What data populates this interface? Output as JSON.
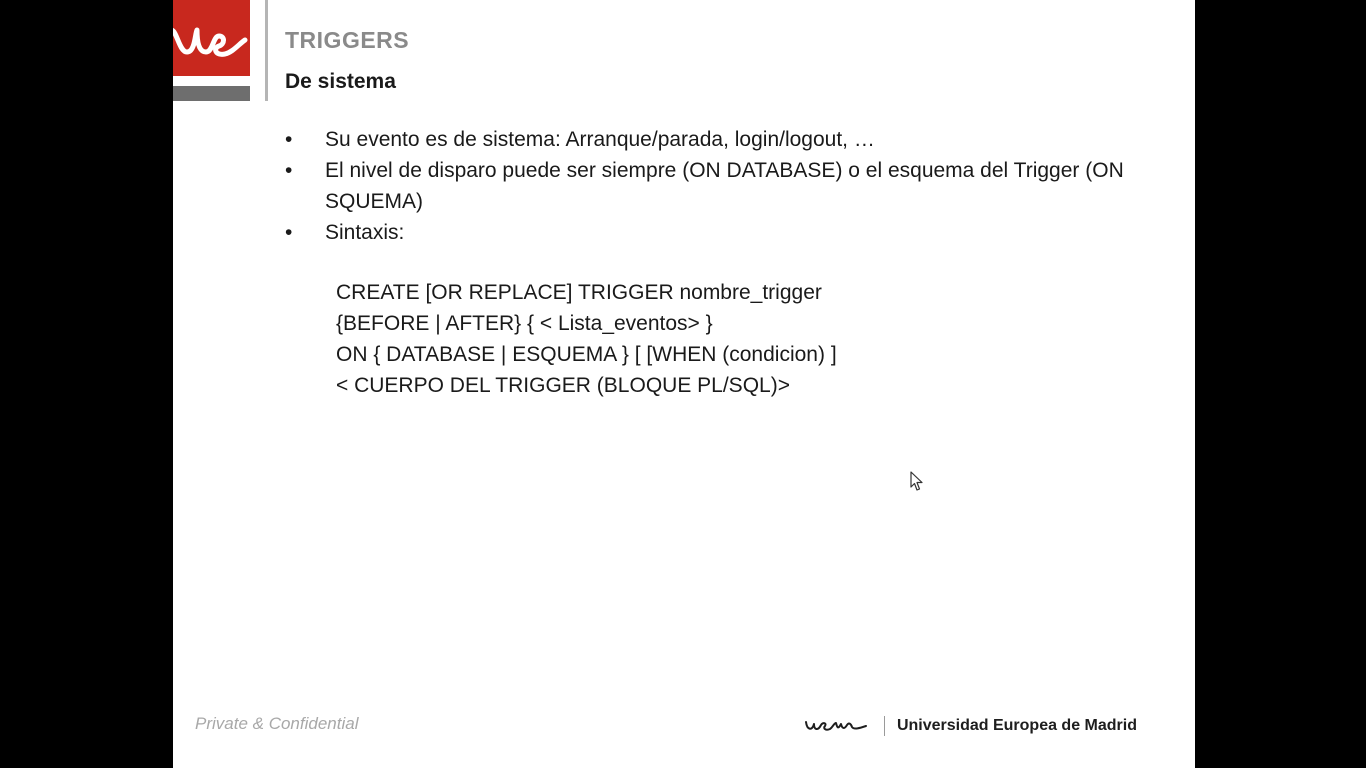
{
  "slide": {
    "title": "TRIGGERS",
    "subtitle": "De sistema",
    "bullets": [
      "Su evento es de sistema: Arranque/parada, login/logout, …",
      "El nivel de disparo puede ser siempre (ON DATABASE) o el esquema del Trigger (ON SQUEMA)",
      "Sintaxis:"
    ],
    "bullet_symbol": "•",
    "code_lines": [
      "CREATE [OR REPLACE] TRIGGER nombre_trigger",
      "{BEFORE | AFTER} { < Lista_eventos> }",
      "ON { DATABASE | ESQUEMA } [ [WHEN (condicion) ]",
      "< CUERPO DEL TRIGGER (BLOQUE PL/SQL)>"
    ]
  },
  "footer": {
    "confidential": "Private & Confidential",
    "university": "Universidad Europea de Madrid"
  },
  "icons": {
    "logo": "ue-logo-icon",
    "footer_logo": "uem-logo-icon",
    "cursor": "mouse-pointer-icon"
  },
  "colors": {
    "brand_red": "#c8281e",
    "title_gray": "#8a8a8a",
    "text": "#1a1a1a",
    "footer_gray": "#a8a8a8"
  }
}
